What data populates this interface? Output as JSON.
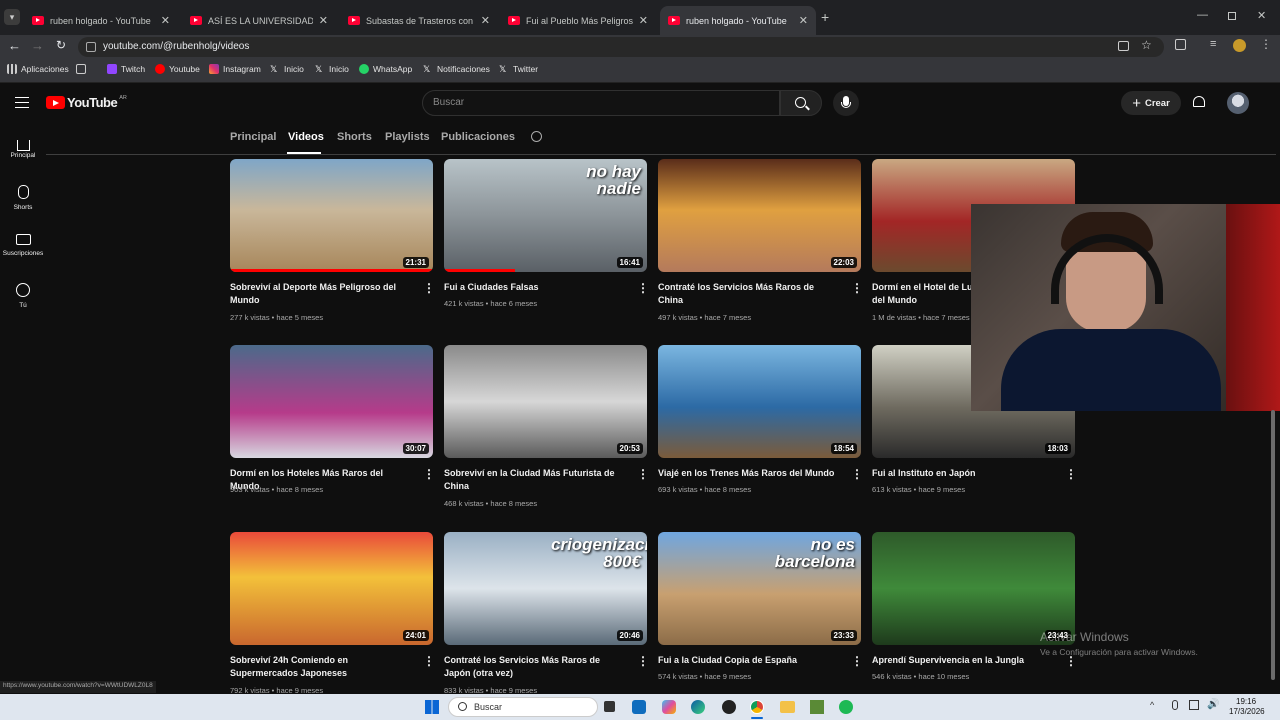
{
  "browser": {
    "tabs": [
      {
        "title": "ruben holgado - YouTube"
      },
      {
        "title": "ASÍ ES LA UNIVERSIDAD DEL FUTURO"
      },
      {
        "title": "Subastas de Trasteros con YouTubers"
      },
      {
        "title": "Fui al Pueblo Más Peligroso del Mundo"
      },
      {
        "title": "ruben holgado - YouTube"
      }
    ],
    "url": "youtube.com/@rubenholg/videos",
    "bookmarks": [
      "Aplicaciones",
      "Twitch",
      "Youtube",
      "Instagram",
      "Inicio",
      "Inicio",
      "WhatsApp",
      "Notificaciones",
      "Twitter"
    ]
  },
  "youtube": {
    "logo_text": "YouTube",
    "country_code": "AR",
    "search_placeholder": "Buscar",
    "create_label": "Crear",
    "sidebar": [
      {
        "label": "Principal",
        "icon": "home-icon"
      },
      {
        "label": "Shorts",
        "icon": "shorts-icon"
      },
      {
        "label": "Suscripciones",
        "icon": "subscriptions-icon"
      },
      {
        "label": "Tú",
        "icon": "you-icon"
      }
    ],
    "channel_tabs": [
      "Principal",
      "Videos",
      "Shorts",
      "Playlists",
      "Publicaciones"
    ],
    "active_tab": "Videos",
    "videos": [
      {
        "title": "Sobreviví al Deporte Más Peligroso del Mundo",
        "meta": "277 k vistas • hace 5 meses",
        "duration": "21:31",
        "watched": 1.0
      },
      {
        "title": "Fui a Ciudades Falsas",
        "meta": "421 k vistas • hace 6 meses",
        "duration": "16:41",
        "watched": 0.35,
        "overlay": "no hay nadie"
      },
      {
        "title": "Contraté los Servicios Más Raros de China",
        "meta": "497 k vistas • hace 7 meses",
        "duration": "22:03",
        "watched": 0.0
      },
      {
        "title": "Dormí en el Hotel de Lujo Más Extraño del Mundo",
        "meta": "1 M de vistas • hace 7 meses",
        "duration": "",
        "watched": 0.0
      },
      {
        "title": "Dormí en los Hoteles Más Raros del Mundo",
        "meta": "903 k vistas • hace 8 meses",
        "duration": "30:07",
        "watched": 0.0
      },
      {
        "title": "Sobreviví en la Ciudad Más Futurista de China",
        "meta": "468 k vistas • hace 8 meses",
        "duration": "20:53",
        "watched": 0.0
      },
      {
        "title": "Viajé en los Trenes Más Raros del Mundo",
        "meta": "693 k vistas • hace 8 meses",
        "duration": "18:54",
        "watched": 0.0
      },
      {
        "title": "Fui al Instituto en Japón",
        "meta": "613 k vistas • hace 9 meses",
        "duration": "18:03",
        "watched": 0.0
      },
      {
        "title": "Sobreviví 24h Comiendo en Supermercados Japoneses",
        "meta": "792 k vistas • hace 9 meses",
        "duration": "24:01",
        "watched": 0.0
      },
      {
        "title": "Contraté los Servicios Más Raros de Japón (otra vez)",
        "meta": "833 k vistas • hace 9 meses",
        "duration": "20:46",
        "watched": 0.0,
        "overlay": "criogenización 800€"
      },
      {
        "title": "Fui a la Ciudad Copia de España",
        "meta": "574 k vistas • hace 9 meses",
        "duration": "23:33",
        "watched": 0.0,
        "overlay": "no es barcelona"
      },
      {
        "title": "Aprendí Supervivencia en la Jungla",
        "meta": "546 k vistas • hace 10 meses",
        "duration": "23:43",
        "watched": 0.0
      }
    ],
    "status_url": "https://www.youtube.com/watch?v=WWtUDWLZ0L8"
  },
  "windows": {
    "activate_title": "Activar Windows",
    "activate_sub": "Ve a Configuración para activar Windows.",
    "search_placeholder": "Buscar",
    "time": "19:16",
    "date": "17/3/2026"
  },
  "colors": {
    "accent": "#ff0000",
    "bg": "#0f0f0f"
  }
}
